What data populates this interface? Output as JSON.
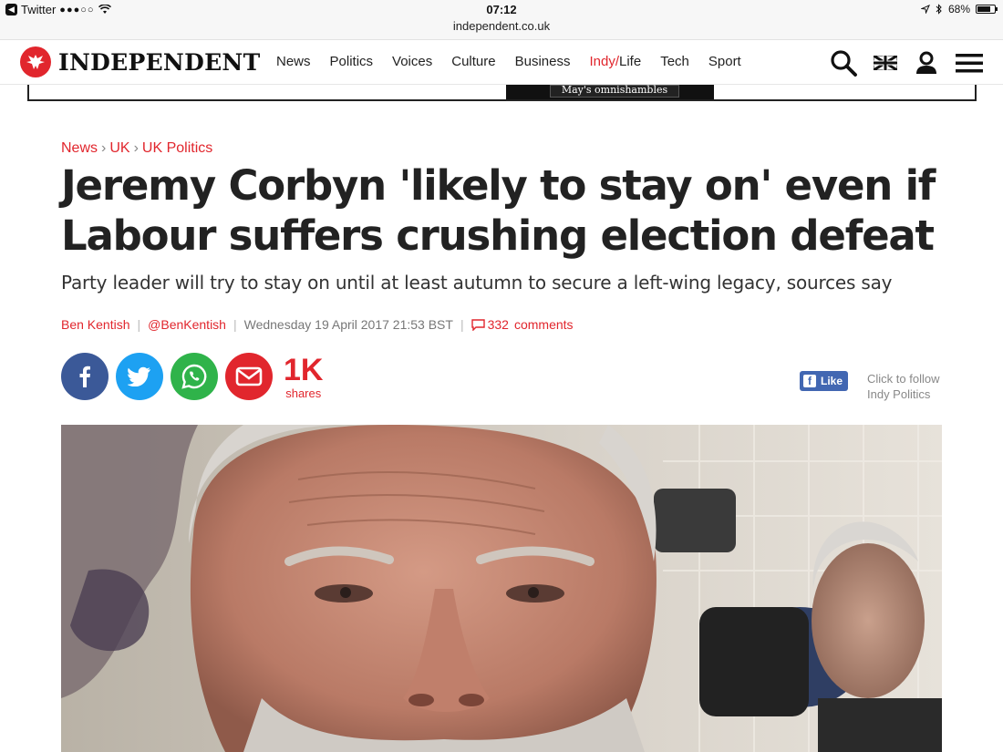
{
  "status_bar": {
    "back_app": "Twitter",
    "signal": "●●●○○",
    "time": "07:12",
    "url": "independent.co.uk",
    "battery": "68%"
  },
  "header": {
    "logo_text": "INDEPENDENT",
    "nav": [
      "News",
      "Politics",
      "Voices",
      "Culture",
      "Business",
      "Indy/Life",
      "Tech",
      "Sport"
    ],
    "nav_indy_prefix": "Indy/",
    "nav_indy_suffix": "Life",
    "ad_text": "May's omnishambles"
  },
  "article": {
    "breadcrumb": [
      "News",
      "UK",
      "UK Politics"
    ],
    "breadcrumb_sep": "›",
    "headline": "Jeremy Corbyn 'likely to stay on' even if Labour suffers crushing election defeat",
    "standfirst": "Party leader will try to stay on until at least autumn to secure a left-wing legacy, sources say",
    "author": "Ben Kentish",
    "twitter_handle": "@BenKentish",
    "date": "Wednesday 19 April 2017 21:53 BST",
    "comment_count": "332",
    "comments_label": "comments",
    "share_count": "1K",
    "share_label": "shares",
    "fb_like": "Like",
    "follow_line1": "Click to follow",
    "follow_line2": "Indy Politics"
  },
  "colors": {
    "brand_red": "#e1262d",
    "facebook": "#3b5998",
    "twitter": "#1da1f2",
    "whatsapp": "#2fb34a"
  }
}
